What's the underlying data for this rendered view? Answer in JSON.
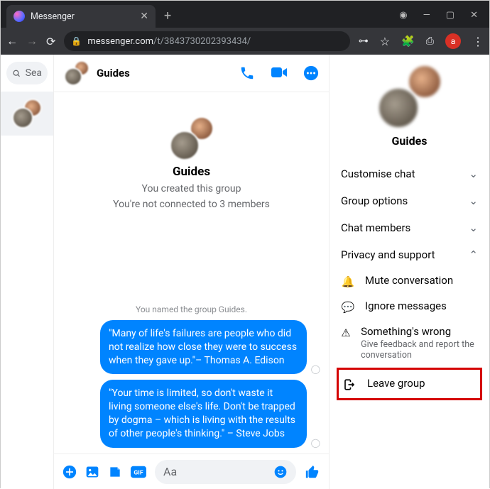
{
  "browser": {
    "tab_title": "Messenger",
    "url_host": "messenger.com",
    "url_path": "/t/3843730202393434/",
    "profile_letter": "a"
  },
  "sidebar": {
    "search_placeholder": "Sea"
  },
  "chat": {
    "title": "Guides",
    "group_name": "Guides",
    "created_text": "You created this group",
    "not_connected_text": "You're not connected to 3 members",
    "system_notice": "You named the group Guides.",
    "messages": [
      "\"Many of life's failures are people who did not realize how close they were to success when they gave up.\"– Thomas A. Edison",
      "\"Your time is limited, so don't waste it living someone else's life. Don't be trapped by dogma – which is living with the results of other people's thinking.\" – Steve Jobs"
    ],
    "composer_placeholder": "Aa"
  },
  "panel": {
    "title": "Guides",
    "sections": {
      "customise": "Customise chat",
      "group_options": "Group options",
      "chat_members": "Chat members",
      "privacy": "Privacy and support"
    },
    "privacy_items": {
      "mute": "Mute conversation",
      "ignore": "Ignore messages",
      "wrong": "Something's wrong",
      "wrong_desc": "Give feedback and report the conversation",
      "leave": "Leave group"
    }
  }
}
